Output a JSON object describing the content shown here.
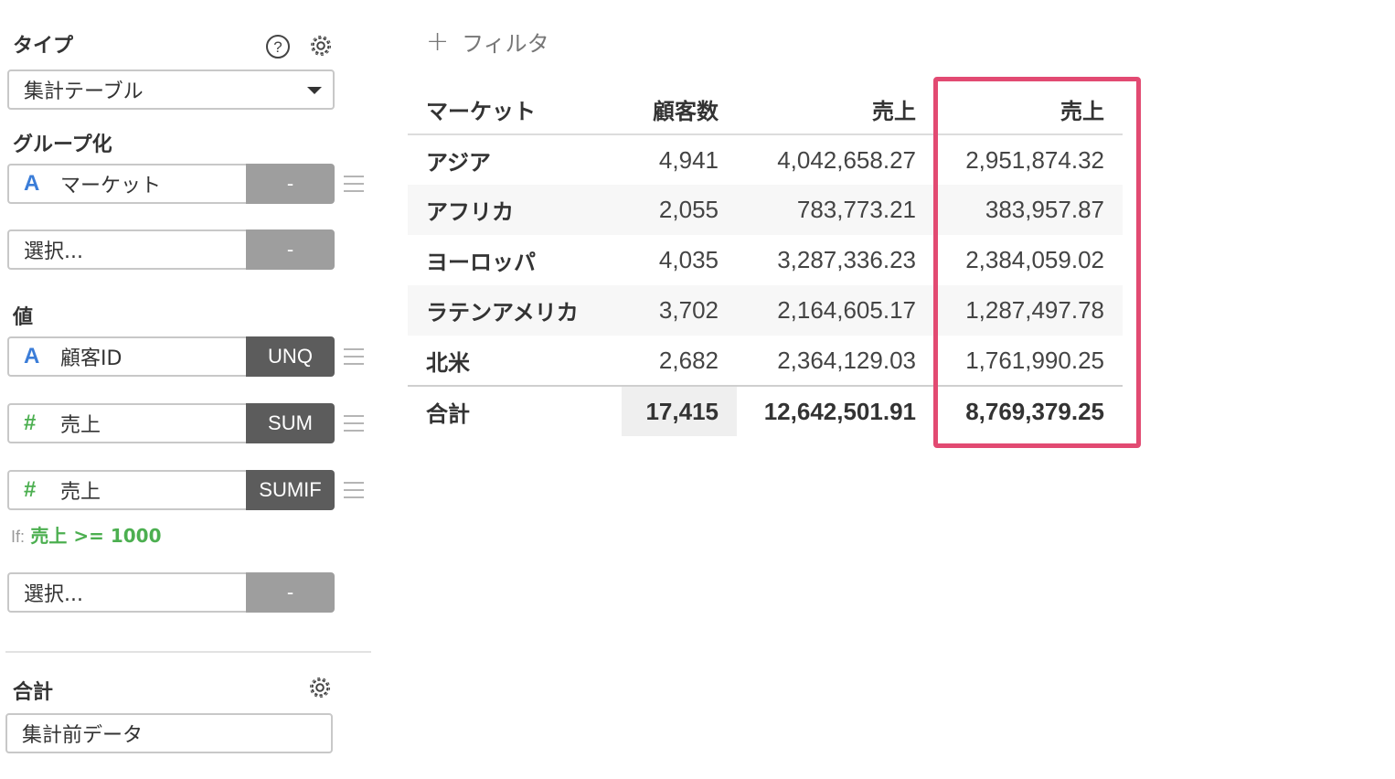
{
  "sidebar": {
    "type_label": "タイプ",
    "type_value": "集計テーブル",
    "group_label": "グループ化",
    "group_fields": [
      {
        "name": "マーケット",
        "type_icon": "A",
        "op": "-"
      },
      {
        "name": "選択...",
        "op": "-"
      }
    ],
    "value_label": "値",
    "value_fields": [
      {
        "name": "顧客ID",
        "type_icon": "A",
        "op": "UNQ"
      },
      {
        "name": "売上",
        "type_icon": "#",
        "op": "SUM"
      },
      {
        "name": "売上",
        "type_icon": "#",
        "op": "SUMIF"
      },
      {
        "name": "選択...",
        "op": "-"
      }
    ],
    "if_prefix": "If:",
    "if_expression": "売上 >= 1000",
    "total_label": "合計",
    "total_value": "集計前データ"
  },
  "filter": {
    "label": "フィルタ",
    "plus": "+"
  },
  "table": {
    "headers": [
      "マーケット",
      "顧客数",
      "売上",
      "売上"
    ],
    "rows": [
      [
        "アジア",
        "4,941",
        "4,042,658.27",
        "2,951,874.32"
      ],
      [
        "アフリカ",
        "2,055",
        "783,773.21",
        "383,957.87"
      ],
      [
        "ヨーロッパ",
        "4,035",
        "3,287,336.23",
        "2,384,059.02"
      ],
      [
        "ラテンアメリカ",
        "3,702",
        "2,164,605.17",
        "1,287,497.78"
      ],
      [
        "北米",
        "2,682",
        "2,364,129.03",
        "1,761,990.25"
      ]
    ],
    "total": [
      "合計",
      "17,415",
      "12,642,501.91",
      "8,769,379.25"
    ]
  },
  "colors": {
    "highlight": "#e24a72",
    "string_type": "#3b7dd8",
    "number_type": "#4caf50"
  },
  "icons": [
    "help-icon",
    "gear-icon",
    "drag-handle-icon",
    "caret-down-icon",
    "plus-icon"
  ]
}
